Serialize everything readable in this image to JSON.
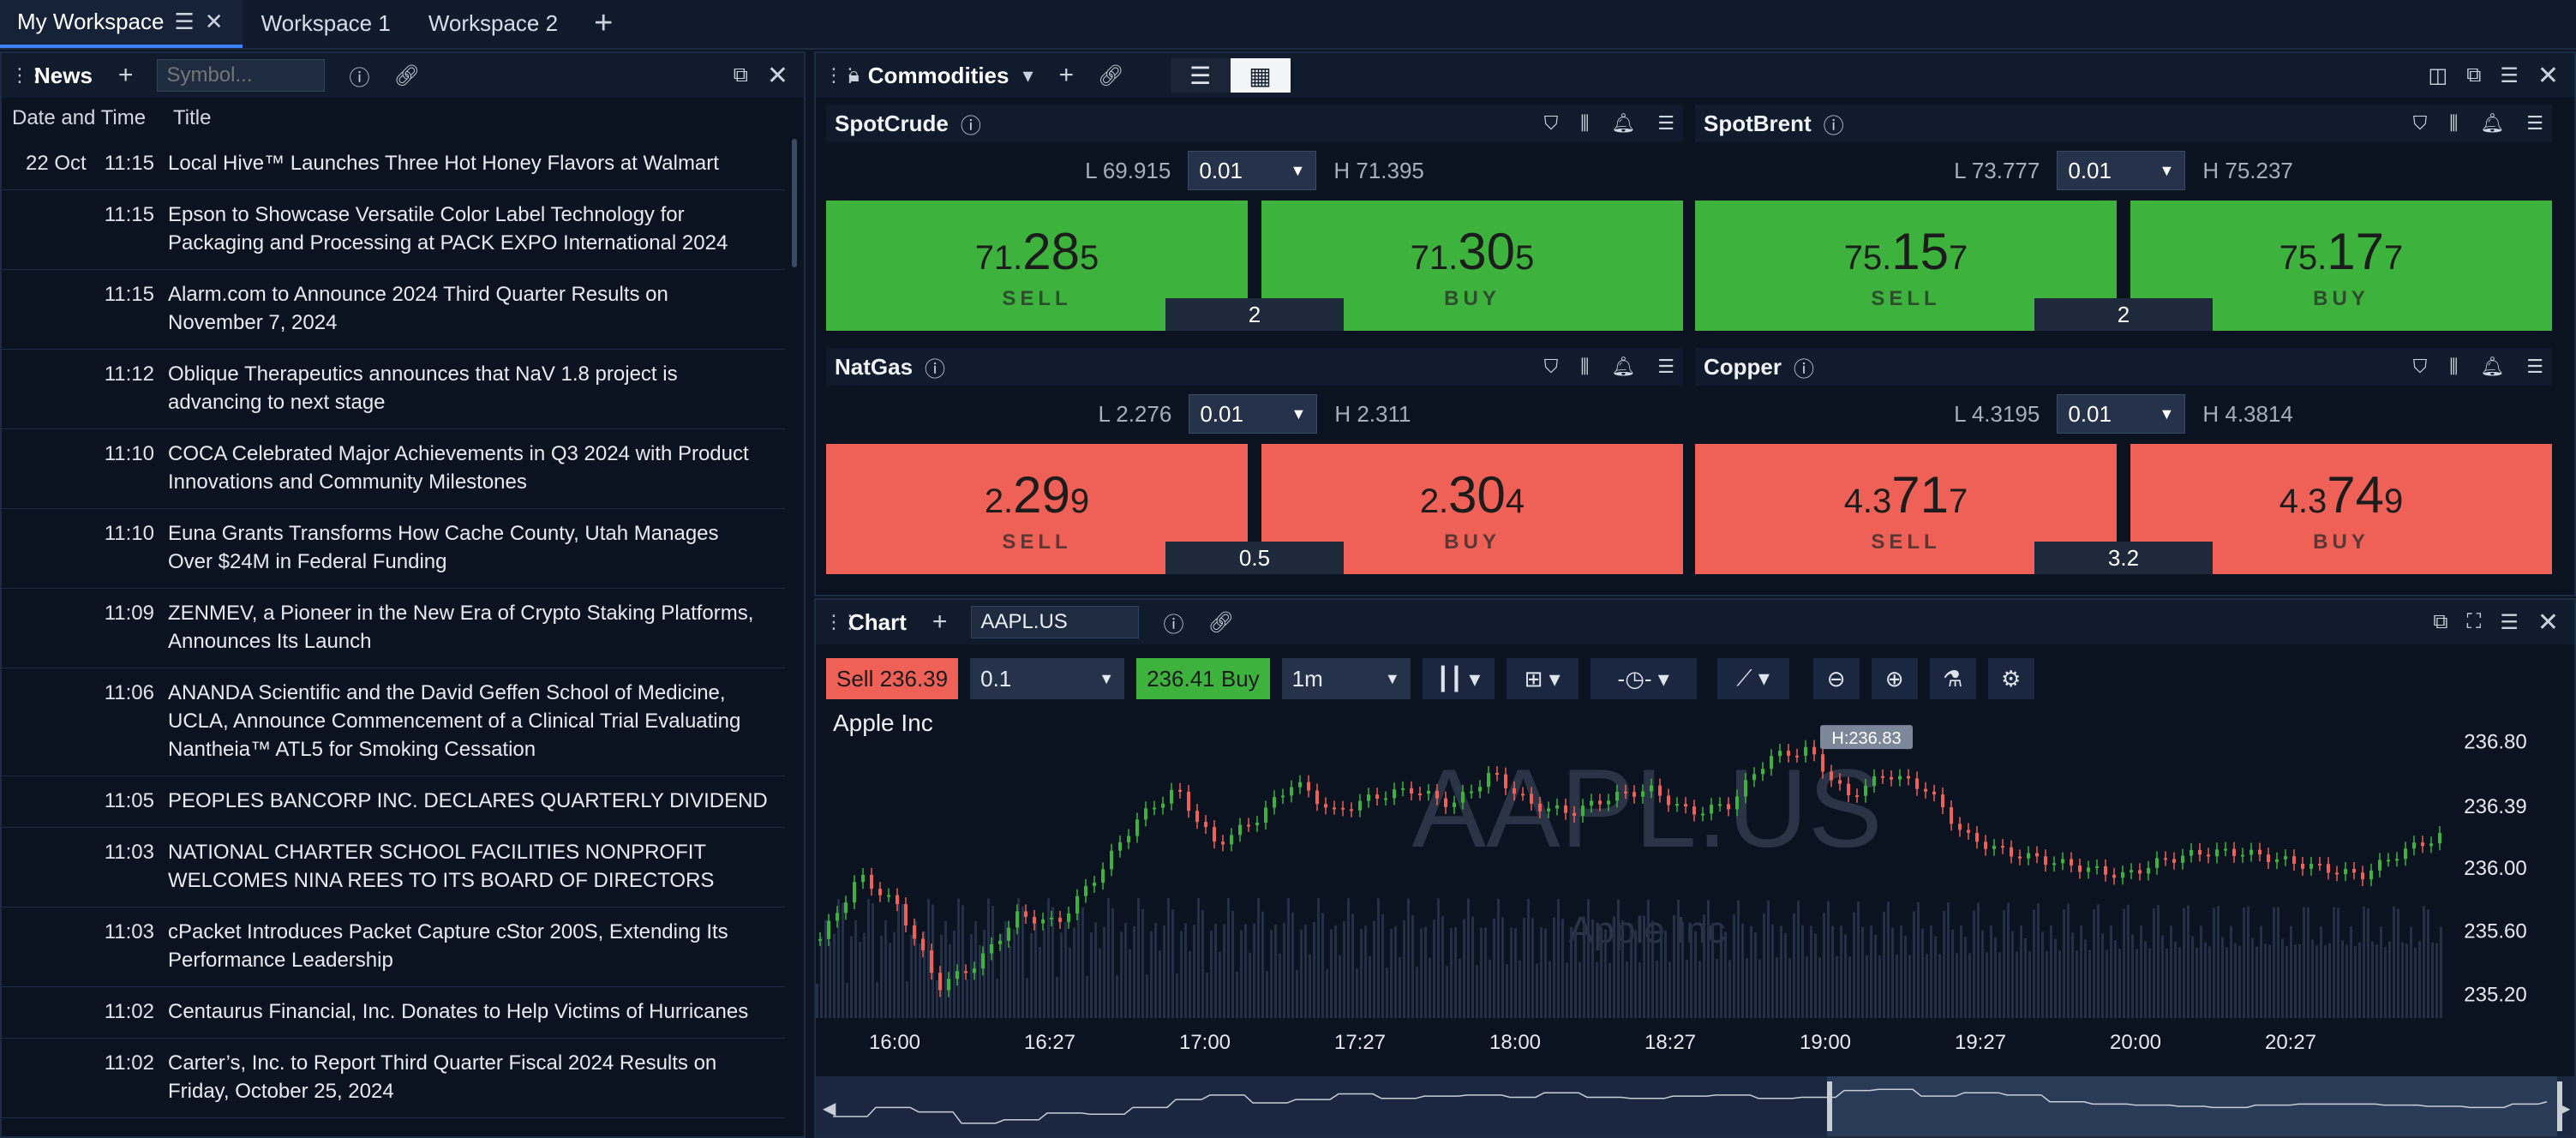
{
  "workspace_tabs": [
    {
      "label": "My Workspace",
      "active": true
    },
    {
      "label": "Workspace 1",
      "active": false
    },
    {
      "label": "Workspace 2",
      "active": false
    }
  ],
  "news": {
    "title": "News",
    "symbol_placeholder": "Symbol...",
    "columns": {
      "datetime": "Date and Time",
      "title": "Title"
    },
    "rows": [
      {
        "date": "22 Oct",
        "time": "11:15",
        "title": "Local Hive™ Launches Three Hot Honey Flavors at Walmart"
      },
      {
        "date": "",
        "time": "11:15",
        "title": "Epson to Showcase Versatile Color Label Technology for Packaging and Processing at PACK EXPO International 2024"
      },
      {
        "date": "",
        "time": "11:15",
        "title": "Alarm.com to Announce 2024 Third Quarter Results on November 7, 2024"
      },
      {
        "date": "",
        "time": "11:12",
        "title": "Oblique Therapeutics announces that NaV 1.8 project is advancing to next stage"
      },
      {
        "date": "",
        "time": "11:10",
        "title": "COCA Celebrated Major Achievements in Q3 2024 with Product Innovations and Community Milestones"
      },
      {
        "date": "",
        "time": "11:10",
        "title": "Euna Grants Transforms How Cache County, Utah Manages Over $24M in Federal Funding"
      },
      {
        "date": "",
        "time": "11:09",
        "title": "ZENMEV, a Pioneer in the New Era of Crypto Staking Platforms, Announces Its Launch"
      },
      {
        "date": "",
        "time": "11:06",
        "title": "ANANDA Scientific and the David Geffen School of Medicine, UCLA, Announce Commencement of a Clinical Trial Evaluating Nantheia™ ATL5 for Smoking Cessation"
      },
      {
        "date": "",
        "time": "11:05",
        "title": "PEOPLES BANCORP INC. DECLARES QUARTERLY DIVIDEND"
      },
      {
        "date": "",
        "time": "11:03",
        "title": "NATIONAL CHARTER SCHOOL FACILITIES NONPROFIT WELCOMES NINA REES TO ITS BOARD OF DIRECTORS"
      },
      {
        "date": "",
        "time": "11:03",
        "title": "cPacket Introduces Packet Capture cStor 200S, Extending Its Performance Leadership"
      },
      {
        "date": "",
        "time": "11:02",
        "title": "Centaurus Financial, Inc. Donates to Help Victims of Hurricanes"
      },
      {
        "date": "",
        "time": "11:02",
        "title": "Carter’s, Inc. to Report Third Quarter Fiscal 2024 Results on Friday, October 25, 2024"
      }
    ]
  },
  "commodities": {
    "title": "Commodities",
    "tiles": [
      {
        "name": "SpotCrude",
        "low": "L 69.915",
        "high": "H 71.395",
        "qty": "0.01",
        "sell": {
          "pre": "71.",
          "big": "28",
          "post": "5"
        },
        "buy": {
          "pre": "71.",
          "big": "30",
          "post": "5"
        },
        "spread": "2",
        "color": "#3db33d",
        "direction": "up"
      },
      {
        "name": "SpotBrent",
        "low": "L 73.777",
        "high": "H 75.237",
        "qty": "0.01",
        "sell": {
          "pre": "75.",
          "big": "15",
          "post": "7"
        },
        "buy": {
          "pre": "75.",
          "big": "17",
          "post": "7"
        },
        "spread": "2",
        "color": "#3db33d",
        "direction": "up"
      },
      {
        "name": "NatGas",
        "low": "L 2.276",
        "high": "H 2.311",
        "qty": "0.01",
        "sell": {
          "pre": "2.",
          "big": "29",
          "post": "9"
        },
        "buy": {
          "pre": "2.",
          "big": "30",
          "post": "4"
        },
        "spread": "0.5",
        "color": "#ef6057",
        "direction": "down"
      },
      {
        "name": "Copper",
        "low": "L 4.3195",
        "high": "H 4.3814",
        "qty": "0.01",
        "sell": {
          "pre": "4.3",
          "big": "71",
          "post": "7"
        },
        "buy": {
          "pre": "4.3",
          "big": "74",
          "post": "9"
        },
        "spread": "3.2",
        "color": "#ef6057",
        "direction": "down"
      }
    ],
    "sell_label": "SELL",
    "buy_label": "BUY"
  },
  "chart": {
    "title": "Chart",
    "symbol_value": "AAPL.US",
    "sell_btn": "Sell 236.39",
    "buy_btn": "236.41 Buy",
    "qty": "0.1",
    "interval": "1m",
    "company": "Apple Inc",
    "watermark_symbol": "AAPL.US",
    "watermark_name": "Apple Inc",
    "high_label": "H:236.83",
    "colors": {
      "up": "#3db33d",
      "down": "#ef6057",
      "line": "#c9ced6"
    }
  },
  "chart_data": {
    "type": "line",
    "title": "Apple Inc",
    "x_ticks": [
      "16:00",
      "16:27",
      "17:00",
      "17:27",
      "18:00",
      "18:27",
      "19:00",
      "19:27",
      "20:00",
      "20:27"
    ],
    "y_ticks": [
      236.8,
      236.39,
      236.0,
      235.6,
      235.2
    ],
    "ylim": [
      235.05,
      236.95
    ],
    "series": [
      {
        "values": [
          235.55,
          235.95,
          235.75,
          235.25,
          235.4,
          235.7,
          235.65,
          235.95,
          236.3,
          236.5,
          236.15,
          236.3,
          236.55,
          236.35,
          236.45,
          236.5,
          236.4,
          236.6,
          236.4,
          236.35,
          236.45,
          236.5,
          236.35,
          236.4,
          236.7,
          236.75,
          236.45,
          236.6,
          236.5,
          236.2,
          236.1,
          236.05,
          236.0,
          235.95,
          236.05,
          236.1,
          236.1,
          236.05,
          236.0,
          235.95,
          236.1,
          236.2
        ]
      }
    ],
    "grid": false,
    "legend": "none"
  }
}
